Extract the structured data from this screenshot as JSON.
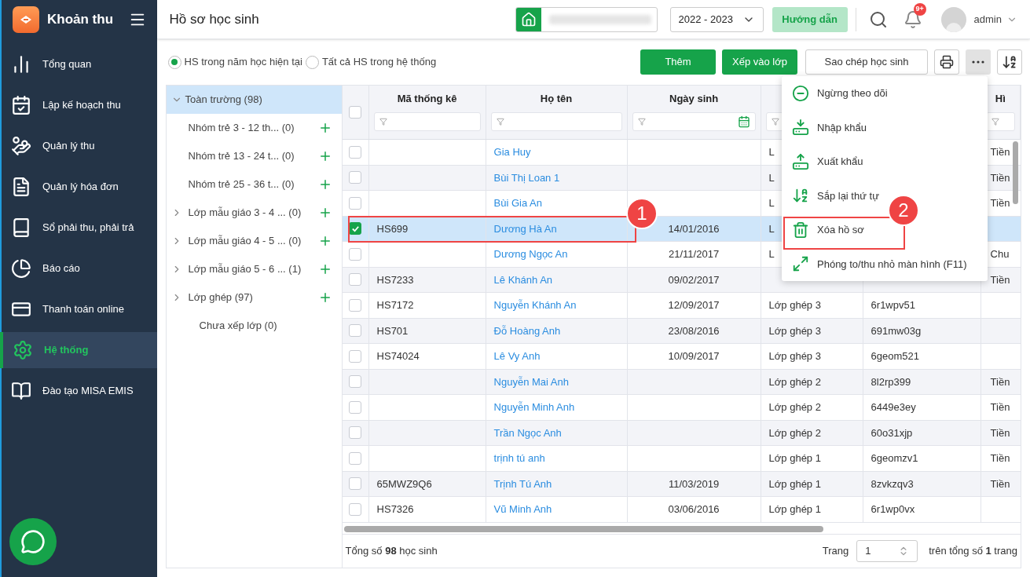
{
  "sidebar": {
    "app_name": "Khoản thu",
    "items": [
      {
        "label": "Tổng quan",
        "selected": false
      },
      {
        "label": "Lập kế hoạch thu",
        "selected": false
      },
      {
        "label": "Quản lý thu",
        "selected": false
      },
      {
        "label": "Quản lý hóa đơn",
        "selected": false
      },
      {
        "label": "Sổ phải thu, phải trả",
        "selected": false
      },
      {
        "label": "Báo cáo",
        "selected": false
      },
      {
        "label": "Thanh toán online",
        "selected": false
      },
      {
        "label": "Hệ thống",
        "selected": true
      },
      {
        "label": "Đào tạo MISA EMIS",
        "selected": false
      }
    ]
  },
  "header": {
    "title": "Hồ sơ học sinh",
    "year": "2022 - 2023",
    "guide_button": "Hướng dẫn",
    "notification_badge": "9+",
    "user": "admin"
  },
  "filters": [
    {
      "label": "HS trong năm học hiện tại",
      "selected": true
    },
    {
      "label": "Tất cả HS trong hệ thống",
      "selected": false
    }
  ],
  "toolbar": {
    "buttons": [
      {
        "label": "Thêm",
        "kind": "primary"
      },
      {
        "label": "Xếp vào lớp",
        "kind": "primary"
      },
      {
        "label": "Sao chép học sinh",
        "kind": "secondary"
      }
    ]
  },
  "tree": {
    "label": "Toàn trường (98)",
    "selected": true,
    "expanded": true,
    "children": [
      {
        "label": "Nhóm trẻ 3 - 12 th...",
        "count": "(0)",
        "expandable": false,
        "addable": true
      },
      {
        "label": "Nhóm trẻ 13 - 24 t...",
        "count": "(0)",
        "expandable": false,
        "addable": true
      },
      {
        "label": "Nhóm trẻ 25 - 36 t...",
        "count": "(0)",
        "expandable": false,
        "addable": true
      },
      {
        "label": "Lớp mẫu giáo 3 - 4 ...",
        "count": "(0)",
        "expandable": true,
        "addable": true
      },
      {
        "label": "Lớp mẫu giáo 4 - 5 ...",
        "count": "(0)",
        "expandable": true,
        "addable": true
      },
      {
        "label": "Lớp mẫu giáo 5 - 6 ...",
        "count": "(1)",
        "expandable": true,
        "addable": true
      },
      {
        "label": "Lớp ghép",
        "count": "(97)",
        "expandable": true,
        "addable": true
      },
      {
        "label": "Chưa xếp lớp",
        "count": "(0)",
        "expandable": false,
        "addable": false
      }
    ]
  },
  "table": {
    "header_checked": false,
    "columns": [
      "Mã thống kê",
      "Họ tên",
      "Ngày sinh",
      "",
      "",
      "Hì"
    ],
    "rows": [
      {
        "selected": false,
        "code": "",
        "name": "Gia Huy",
        "birth": "",
        "column_5": "L",
        "column_6": "",
        "column_7": "Tiền"
      },
      {
        "selected": false,
        "code": "",
        "name": "Bùi Thị Loan 1",
        "birth": "",
        "column_5": "L",
        "column_6": "",
        "column_7": "Tiền"
      },
      {
        "selected": false,
        "code": "",
        "name": "Bùi Gia An",
        "birth": "",
        "column_5": "L",
        "column_6": "",
        "column_7": "Tiền"
      },
      {
        "selected": true,
        "code": "HS699",
        "name": "Dương Hà An",
        "birth": "14/01/2016",
        "column_5": "L",
        "column_6": "",
        "column_7": ""
      },
      {
        "selected": false,
        "code": "",
        "name": "Dương Ngọc An",
        "birth": "21/11/2017",
        "column_5": "L",
        "column_6": "",
        "column_7": "Chu"
      },
      {
        "selected": false,
        "code": "HS7233",
        "name": "Lê Khánh An",
        "birth": "09/02/2017",
        "column_5": "",
        "column_6": "",
        "column_7": "Tiền"
      },
      {
        "selected": false,
        "code": "HS7172",
        "name": "Nguyễn Khánh An",
        "birth": "12/09/2017",
        "column_5": "Lớp ghép 3",
        "column_6": "6r1wpv51",
        "column_7": ""
      },
      {
        "selected": false,
        "code": "HS701",
        "name": "Đỗ Hoàng Anh",
        "birth": "23/08/2016",
        "column_5": "Lớp ghép 3",
        "column_6": "691mw03g",
        "column_7": ""
      },
      {
        "selected": false,
        "code": "HS74024",
        "name": "Lê Vy Anh",
        "birth": "10/09/2017",
        "column_5": "Lớp ghép 3",
        "column_6": "6geom521",
        "column_7": ""
      },
      {
        "selected": false,
        "code": "",
        "name": "Nguyễn Mai Anh",
        "birth": "",
        "column_5": "Lớp ghép 2",
        "column_6": "8l2rp399",
        "column_7": "Tiền"
      },
      {
        "selected": false,
        "code": "",
        "name": "Nguyễn Minh Anh",
        "birth": "",
        "column_5": "Lớp ghép 2",
        "column_6": "6449e3ey",
        "column_7": "Tiền"
      },
      {
        "selected": false,
        "code": "",
        "name": "Trần Ngọc Anh",
        "birth": "",
        "column_5": "Lớp ghép 2",
        "column_6": "60o31xjp",
        "column_7": "Tiền"
      },
      {
        "selected": false,
        "code": "",
        "name": "trịnh tú anh",
        "birth": "",
        "column_5": "Lớp ghép 1",
        "column_6": "6geomzv1",
        "column_7": "Tiền"
      },
      {
        "selected": false,
        "code": "65MWZ9Q6",
        "name": "Trịnh Tú Anh",
        "birth": "11/03/2019",
        "column_5": "Lớp ghép 1",
        "column_6": "8zvkzqv3",
        "column_7": "Tiền"
      },
      {
        "selected": false,
        "code": "HS7326",
        "name": "Vũ Minh Anh",
        "birth": "03/06/2016",
        "column_5": "Lớp ghép 1",
        "column_6": "6r1wp0vx",
        "column_7": ""
      }
    ]
  },
  "footer": {
    "total": "Tổng số **98** học sinh",
    "page_label": "Trang",
    "page": "1",
    "page_total": "trên tổng số **1** trang"
  },
  "menu": {
    "items": [
      {
        "label": "Ngừng theo dõi",
        "kind": "unfollow"
      },
      {
        "label": "Nhập khẩu",
        "kind": "import"
      },
      {
        "label": "Xuất khẩu",
        "kind": "export"
      },
      {
        "label": "Sắp lại thứ tự",
        "kind": "sort"
      },
      {
        "label": "Xóa hồ sơ",
        "kind": "delete"
      },
      {
        "label": "Phóng to/thu nhỏ màn hình (F11)",
        "kind": "fullscreen"
      }
    ]
  },
  "annotations": [
    {
      "label": "1"
    },
    {
      "label": "2"
    }
  ]
}
